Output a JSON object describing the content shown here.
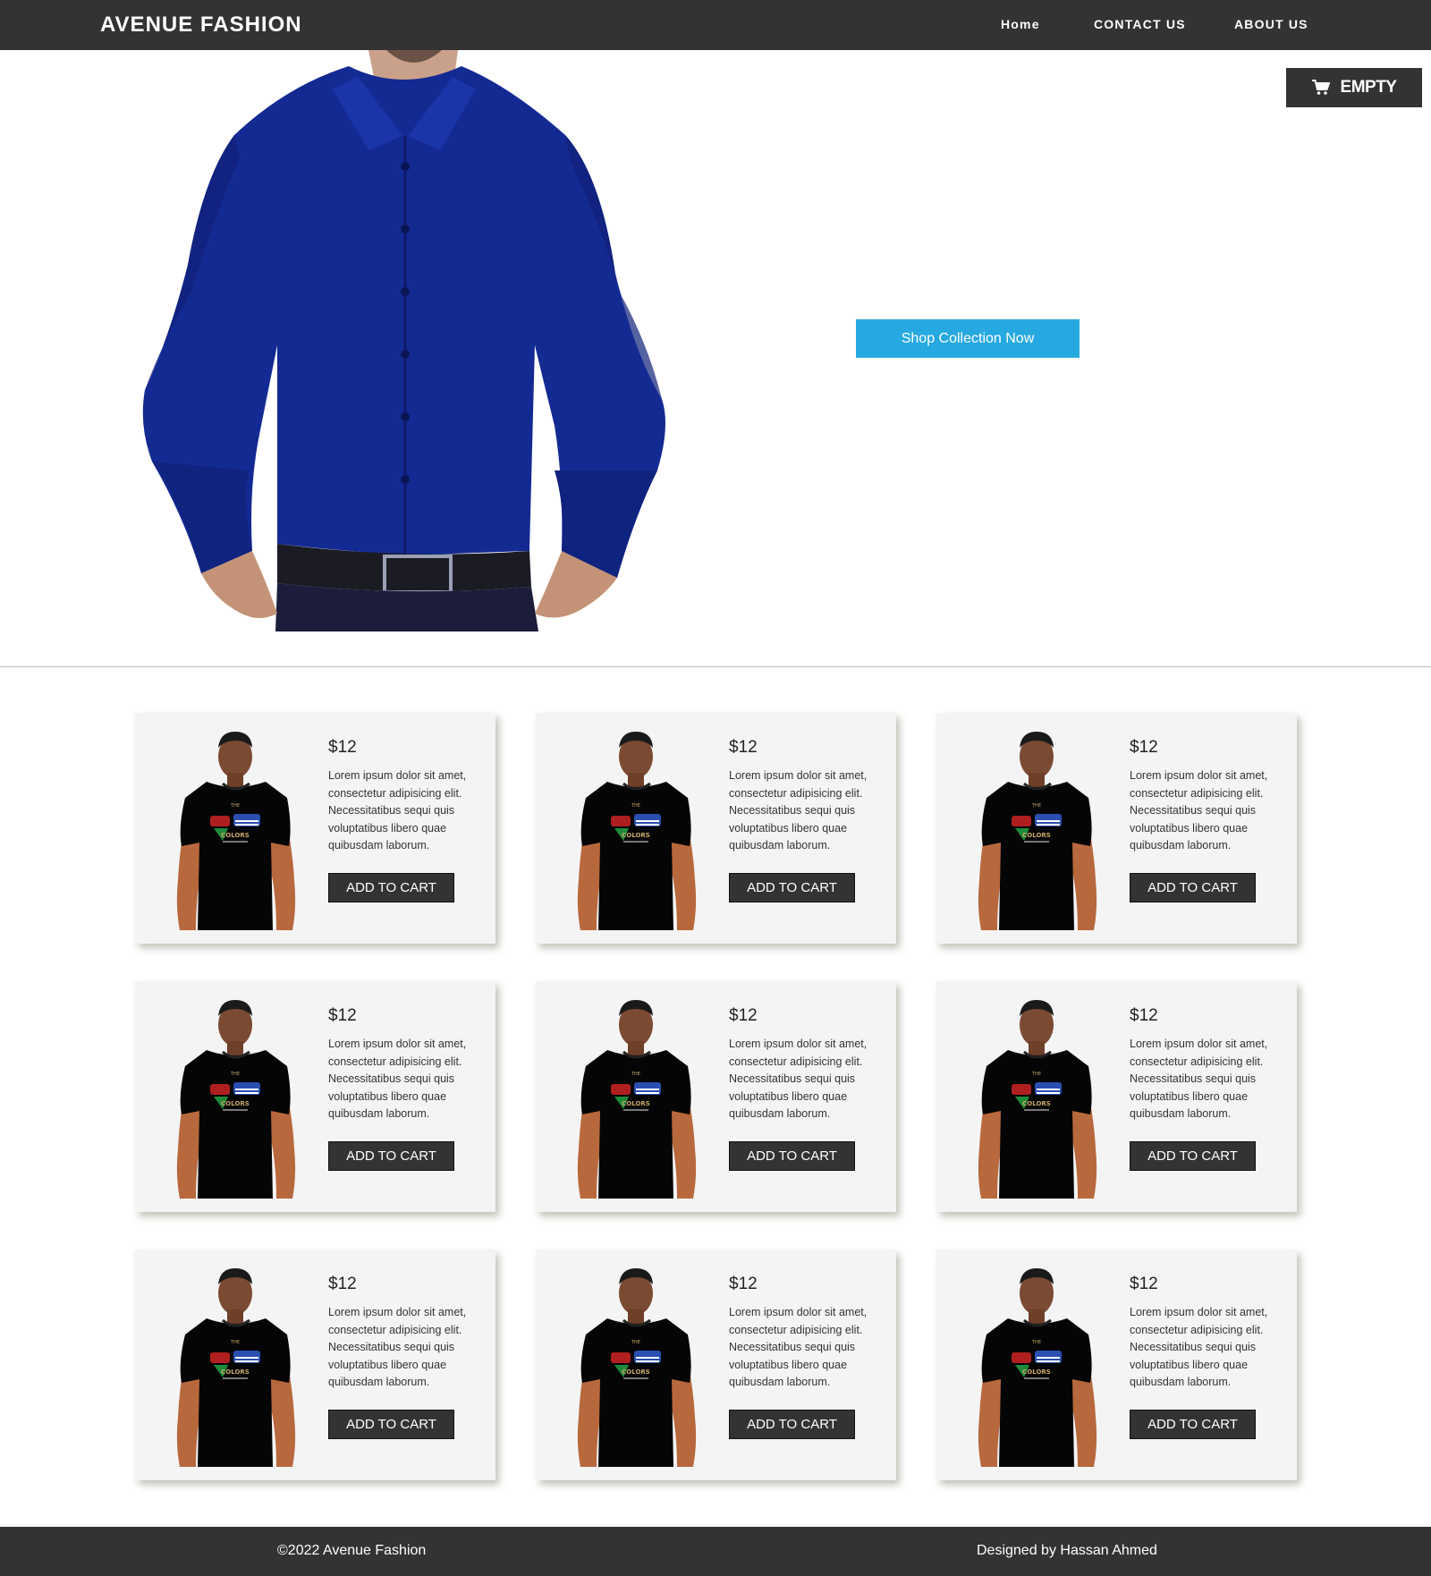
{
  "header": {
    "brand": "AVENUE FASHION",
    "nav": {
      "home": "Home",
      "contact": "CONTACT US",
      "about": "ABOUT US"
    }
  },
  "cart": {
    "label": "EMPTY",
    "icon": "cart-icon"
  },
  "hero": {
    "cta_label": "Shop Collection Now",
    "cta_color": "#26a9e0"
  },
  "products": [
    {
      "price": "$12",
      "description": "Lorem ipsum dolor sit amet, consectetur adipisicing elit. Necessitatibus sequi quis voluptatibus libero quae quibusdam laborum.",
      "button": "ADD TO CART"
    },
    {
      "price": "$12",
      "description": "Lorem ipsum dolor sit amet, consectetur adipisicing elit. Necessitatibus sequi quis voluptatibus libero quae quibusdam laborum.",
      "button": "ADD TO CART"
    },
    {
      "price": "$12",
      "description": "Lorem ipsum dolor sit amet, consectetur adipisicing elit. Necessitatibus sequi quis voluptatibus libero quae quibusdam laborum.",
      "button": "ADD TO CART"
    },
    {
      "price": "$12",
      "description": "Lorem ipsum dolor sit amet, consectetur adipisicing elit. Necessitatibus sequi quis voluptatibus libero quae quibusdam laborum.",
      "button": "ADD TO CART"
    },
    {
      "price": "$12",
      "description": "Lorem ipsum dolor sit amet, consectetur adipisicing elit. Necessitatibus sequi quis voluptatibus libero quae quibusdam laborum.",
      "button": "ADD TO CART"
    },
    {
      "price": "$12",
      "description": "Lorem ipsum dolor sit amet, consectetur adipisicing elit. Necessitatibus sequi quis voluptatibus libero quae quibusdam laborum.",
      "button": "ADD TO CART"
    },
    {
      "price": "$12",
      "description": "Lorem ipsum dolor sit amet, consectetur adipisicing elit. Necessitatibus sequi quis voluptatibus libero quae quibusdam laborum.",
      "button": "ADD TO CART"
    },
    {
      "price": "$12",
      "description": "Lorem ipsum dolor sit amet, consectetur adipisicing elit. Necessitatibus sequi quis voluptatibus libero quae quibusdam laborum.",
      "button": "ADD TO CART"
    },
    {
      "price": "$12",
      "description": "Lorem ipsum dolor sit amet, consectetur adipisicing elit. Necessitatibus sequi quis voluptatibus libero quae quibusdam laborum.",
      "button": "ADD TO CART"
    }
  ],
  "footer": {
    "copyright": "©2022 Avenue Fashion",
    "credit": "Designed by Hassan Ahmed"
  },
  "colors": {
    "bar": "#333333",
    "accent": "#26a9e0",
    "card": "#f4f4f4"
  }
}
